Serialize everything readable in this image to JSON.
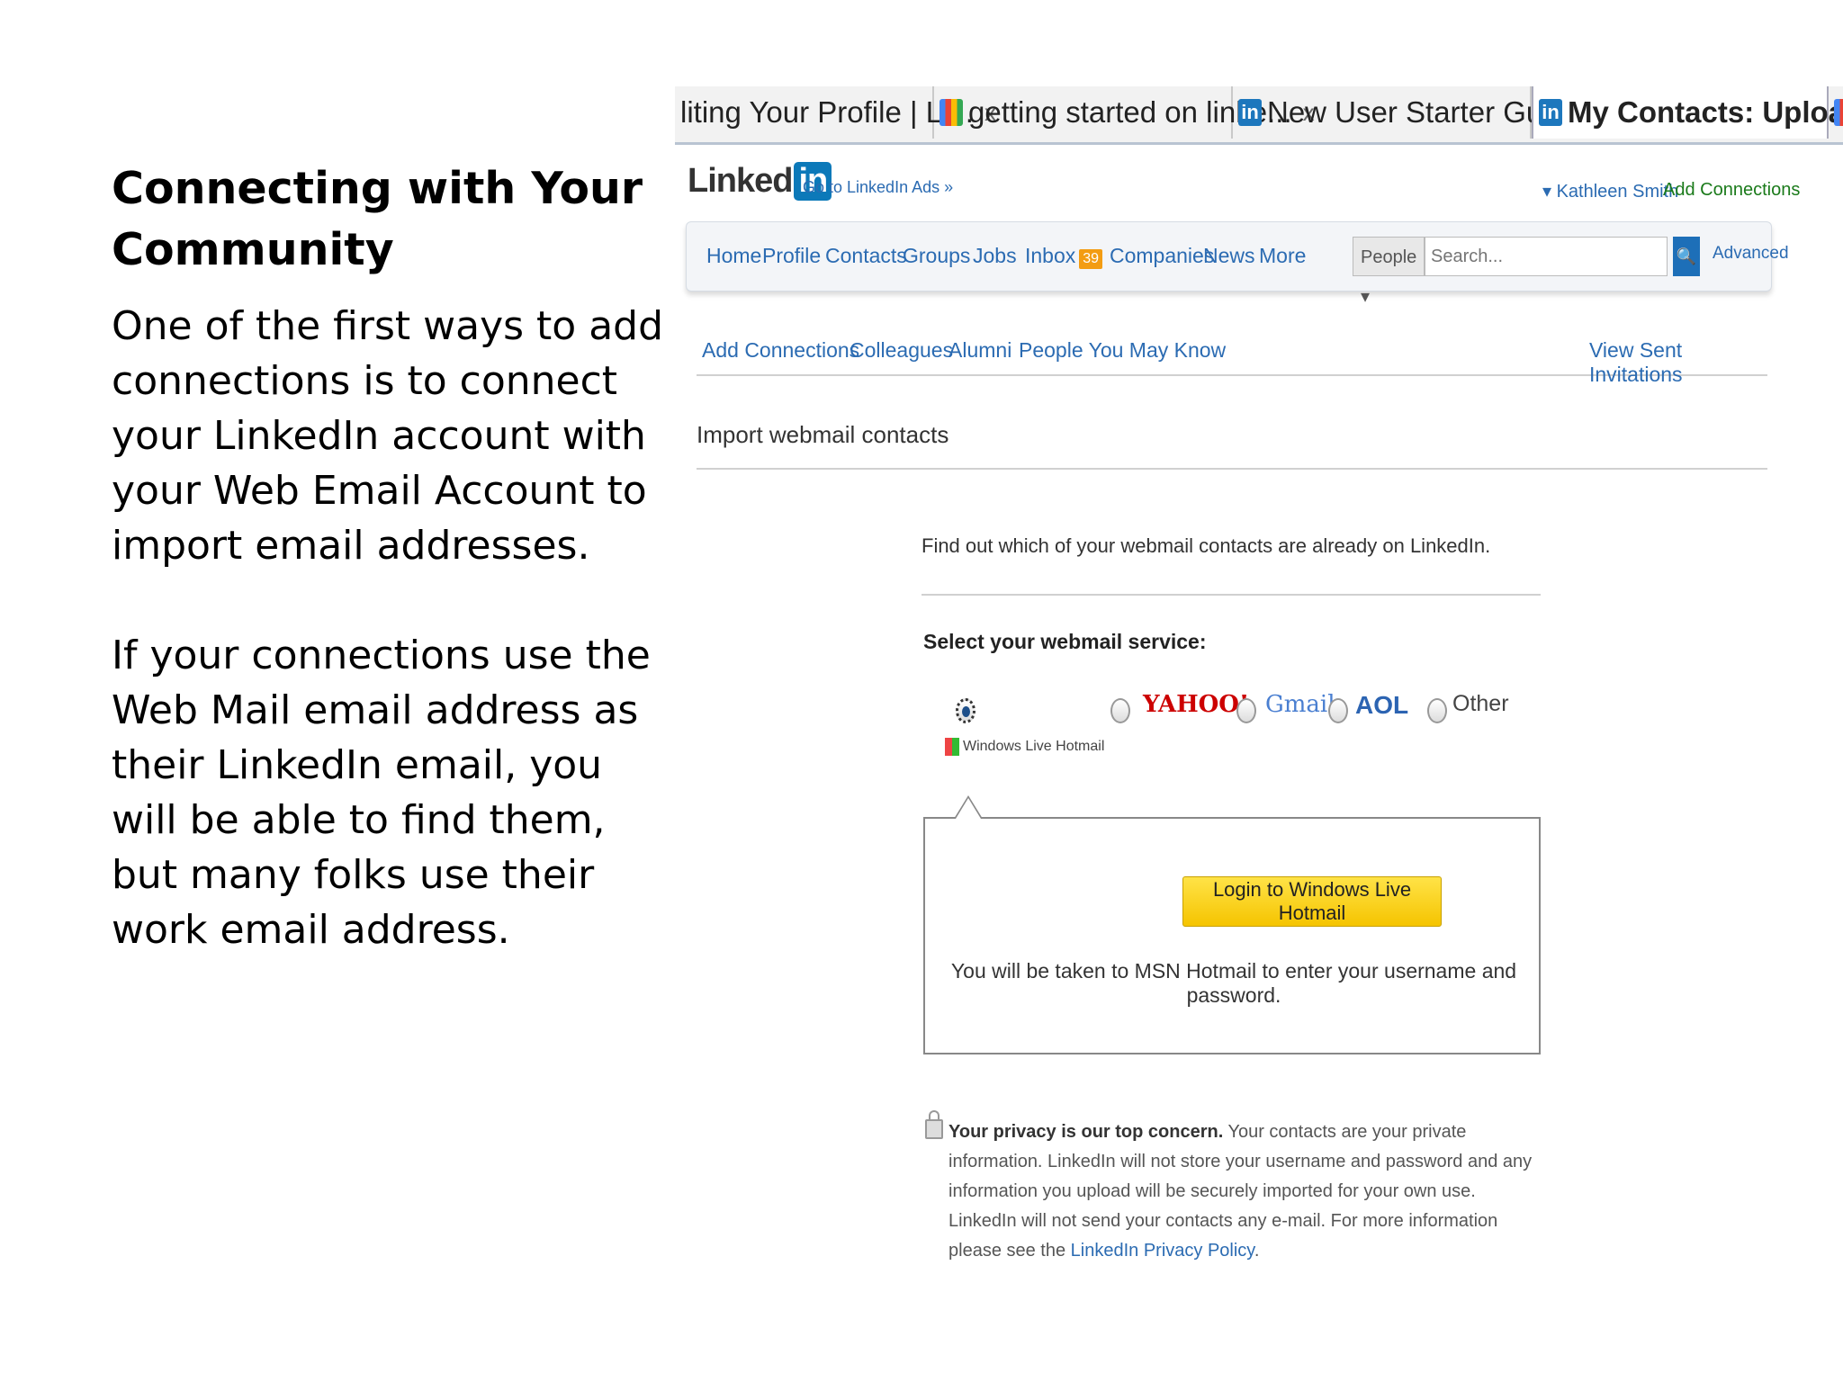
{
  "slide": {
    "title": "Connecting with Your Community",
    "paragraph1": "One of the first ways to add connections is to connect your LinkedIn account with your Web Email Account to import email addresses.",
    "paragraph2": "If your connections use the Web Mail email address as their LinkedIn email, you will be able to find them, but many folks use their work email address."
  },
  "browser": {
    "tabs": [
      {
        "label": "liting Your Profile | Li...",
        "icon": "linkedin-favicon",
        "close": "x"
      },
      {
        "label": "getting started on linke...",
        "icon": "google-favicon",
        "close": "x"
      },
      {
        "label": "New User Starter Guide...",
        "icon": "linkedin-favicon",
        "close": "x"
      },
      {
        "label": "My Contacts: Upload ...",
        "icon": "linkedin-favicon",
        "close": "x",
        "active": true
      }
    ]
  },
  "linkedin": {
    "logo_text": "Linked",
    "logo_in": "in",
    "ads_link": "Go to LinkedIn Ads »",
    "user_name": "▾ Kathleen Smith",
    "add_connections": "Add Connections",
    "nav": {
      "home": "Home",
      "profile": "Profile",
      "contacts": "Contacts",
      "groups": "Groups",
      "jobs": "Jobs",
      "inbox": "Inbox",
      "inbox_count": "39",
      "companies": "Companies",
      "news": "News",
      "more": "More"
    },
    "search": {
      "scope": "People ▾",
      "placeholder": "Search...",
      "button": "🔍",
      "advanced": "Advanced"
    },
    "subnav": {
      "add_connections": "Add Connections",
      "colleagues": "Colleagues",
      "alumni": "Alumni",
      "people_you_may_know": "People You May Know",
      "view_sent": "View Sent Invitations"
    },
    "import_heading": "Import webmail contacts",
    "intro": "Find out which of your webmail contacts are already on LinkedIn.",
    "select_label": "Select your webmail service:",
    "services": {
      "hotmail": "Windows Live Hotmail",
      "yahoo": "YAHOO!",
      "gmail": "Gmail",
      "aol": "AOL",
      "other": "Other"
    },
    "login_button": "Login to Windows Live Hotmail",
    "login_note": "You will be taken to MSN Hotmail to enter your username and password.",
    "privacy": {
      "bold": "Your privacy is our top concern.",
      "text": " Your contacts are your private information. LinkedIn will not store your username and password and any information you upload will be securely imported for your own use. LinkedIn will not send your contacts any e-mail. For more information please see the ",
      "link": "LinkedIn Privacy Policy",
      "end": "."
    }
  },
  "colors": {
    "linkedin_blue": "#0c79b9",
    "link_blue": "#2b6bb2",
    "login_yellow": "#f5c400"
  }
}
